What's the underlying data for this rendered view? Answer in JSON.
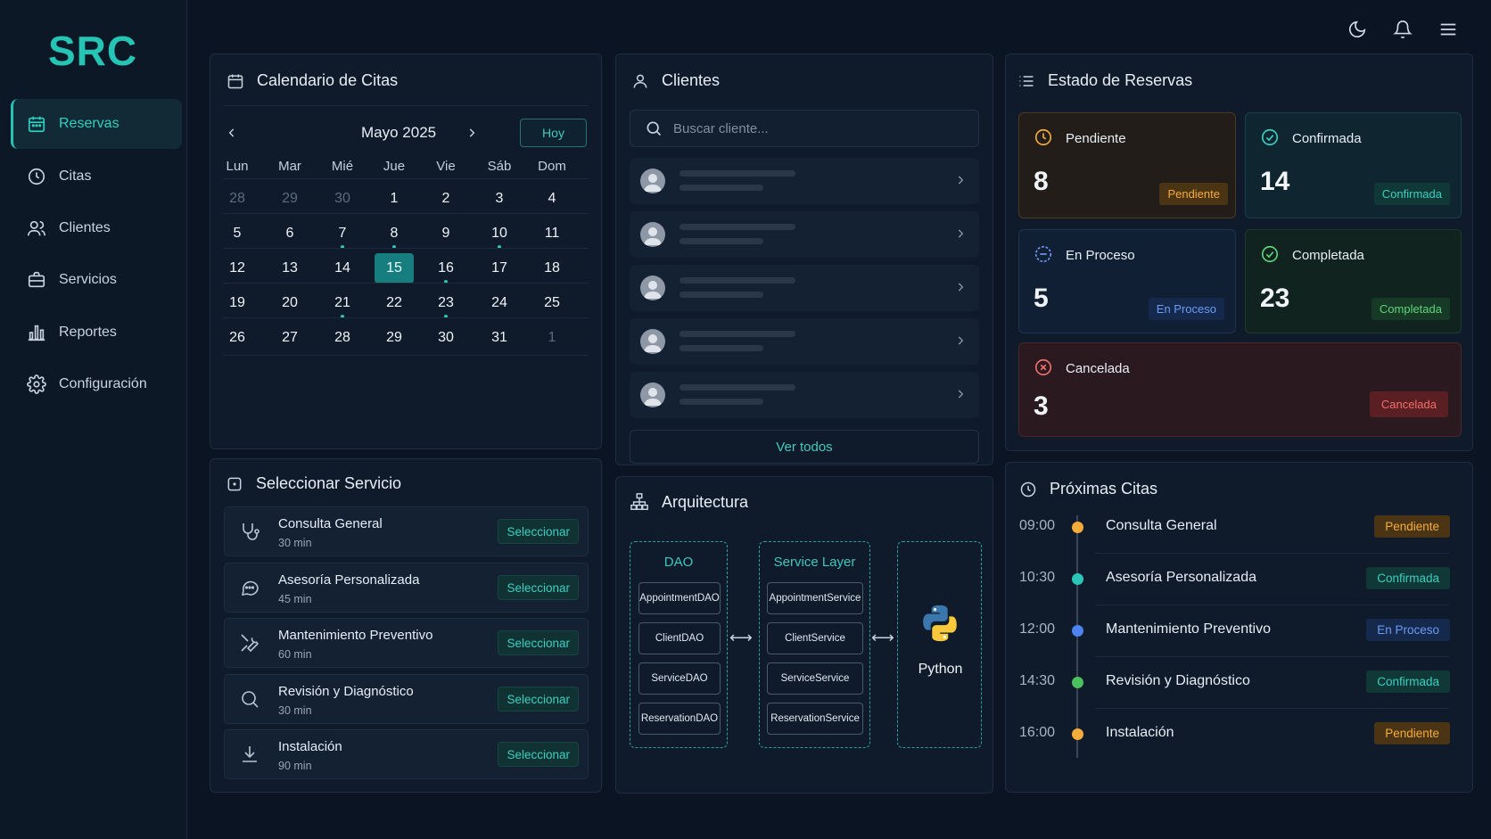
{
  "brand": "SRC",
  "nav": [
    {
      "label": "Reservas",
      "icon": "calendar-icon",
      "active": true
    },
    {
      "label": "Citas",
      "icon": "clock-icon"
    },
    {
      "label": "Clientes",
      "icon": "users-icon"
    },
    {
      "label": "Servicios",
      "icon": "briefcase-icon"
    },
    {
      "label": "Reportes",
      "icon": "bar-chart-icon"
    },
    {
      "label": "Configuración",
      "icon": "gear-icon"
    }
  ],
  "topbar": {
    "icons": [
      "moon-icon",
      "bell-icon",
      "menu-icon"
    ]
  },
  "calendar": {
    "title": "Calendario de Citas",
    "month": "Mayo 2025",
    "today_label": "Hoy",
    "weekdays": [
      "Lun",
      "Mar",
      "Mié",
      "Jue",
      "Vie",
      "Sáb",
      "Dom"
    ],
    "weeks": [
      [
        "28",
        "29",
        "30",
        "1",
        "2",
        "3",
        "4"
      ],
      [
        "5",
        "6",
        "7",
        "8",
        "9",
        "10",
        "11"
      ],
      [
        "12",
        "13",
        "14",
        "15",
        "16",
        "17",
        "18"
      ],
      [
        "19",
        "20",
        "21",
        "22",
        "23",
        "24",
        "25"
      ],
      [
        "26",
        "27",
        "28",
        "29",
        "30",
        "31",
        "1"
      ]
    ],
    "selected_day": "15"
  },
  "clients": {
    "title": "Clientes",
    "search_placeholder": "Buscar cliente...",
    "rows": 5,
    "view_all": "Ver todos"
  },
  "status": {
    "title": "Estado de Reservas",
    "cards": [
      {
        "name": "Pendiente",
        "count": "8",
        "badge": "Pendiente",
        "color": "#f5ac3a",
        "icon": "clock-icon"
      },
      {
        "name": "Confirmada",
        "count": "14",
        "badge": "Confirmada",
        "color": "#3ad0c1",
        "icon": "check-circle-icon"
      },
      {
        "name": "En Proceso",
        "count": "5",
        "badge": "En Proceso",
        "color": "#6b9bf2",
        "icon": "progress-icon"
      },
      {
        "name": "Completada",
        "count": "23",
        "badge": "Completada",
        "color": "#5fd37b",
        "icon": "check-circle-icon"
      },
      {
        "name": "Cancelada",
        "count": "3",
        "badge": "Cancelada",
        "color": "#f06d6d",
        "icon": "x-circle-icon"
      }
    ]
  },
  "services": {
    "title": "Seleccionar Servicio",
    "select_label": "Seleccionar",
    "items": [
      {
        "name": "Consulta General",
        "duration": "30 min",
        "icon": "stethoscope-icon"
      },
      {
        "name": "Asesoría Personalizada",
        "duration": "45 min",
        "icon": "chat-icon"
      },
      {
        "name": "Mantenimiento Preventivo",
        "duration": "60 min",
        "icon": "tools-icon"
      },
      {
        "name": "Revisión y Diagnóstico",
        "duration": "30 min",
        "icon": "search-icon"
      },
      {
        "name": "Instalación",
        "duration": "90 min",
        "icon": "download-icon"
      }
    ]
  },
  "architecture": {
    "title": "Arquitectura",
    "dao": {
      "title": "DAO",
      "items": [
        "AppointmentDAO",
        "ClientDAO",
        "ServiceDAO",
        "ReservationDAO"
      ]
    },
    "service_layer": {
      "title": "Service Layer",
      "items": [
        "AppointmentService",
        "ClientService",
        "ServiceService",
        "ReservationService"
      ]
    },
    "runtime": {
      "label": "Python",
      "icon": "python-logo-icon"
    }
  },
  "upcoming": {
    "title": "Próximas Citas",
    "items": [
      {
        "time": "09:00",
        "name": "Consulta General",
        "status": "Pendiente",
        "color": "#f5ac3a"
      },
      {
        "time": "10:30",
        "name": "Asesoría Personalizada",
        "status": "Confirmada",
        "color": "#2cc6b8"
      },
      {
        "time": "12:00",
        "name": "Mantenimiento Preventivo",
        "status": "En Proceso",
        "color": "#4d83f0"
      },
      {
        "time": "14:30",
        "name": "Revisión y Diagnóstico",
        "status": "Confirmada",
        "color": "#4ac15f"
      },
      {
        "time": "16:00",
        "name": "Instalación",
        "status": "Pendiente",
        "color": "#f5ac3a"
      }
    ]
  }
}
